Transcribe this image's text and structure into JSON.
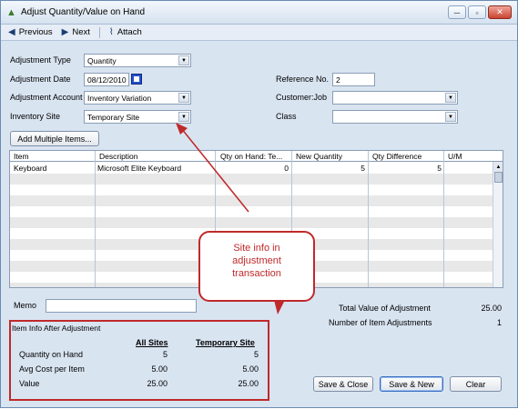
{
  "window": {
    "title": "Adjust Quantity/Value on Hand",
    "min": "─",
    "restore": "▫",
    "close": "✕"
  },
  "toolbar": {
    "previous": "Previous",
    "next": "Next",
    "attach": "Attach"
  },
  "form": {
    "adjustment_type_label": "Adjustment Type",
    "adjustment_type": "Quantity",
    "adjustment_date_label": "Adjustment Date",
    "adjustment_date": "08/12/2010",
    "adjustment_account_label": "Adjustment Account",
    "adjustment_account": "Inventory Variation",
    "inventory_site_label": "Inventory Site",
    "inventory_site": "Temporary Site",
    "reference_label": "Reference No.",
    "reference": "2",
    "customer_job_label": "Customer:Job",
    "customer_job": "",
    "class_label": "Class",
    "class_value": ""
  },
  "add_multiple_items": "Add Multiple Items...",
  "grid": {
    "headers": [
      "Item",
      "Description",
      "Qty on Hand: Te...",
      "New Quantity",
      "Qty Difference",
      "U/M"
    ],
    "rows": [
      {
        "item": "Keyboard",
        "description": "Microsoft Elite Keyboard",
        "qty_on_hand": "0",
        "new_quantity": "5",
        "qty_difference": "5",
        "um": ""
      }
    ]
  },
  "callout": {
    "line1": "Site info in",
    "line2": "adjustment",
    "line3": "transaction"
  },
  "memo_label": "Memo",
  "totals": {
    "total_value_label": "Total Value of Adjustment",
    "total_value": "25.00",
    "num_adjustments_label": "Number of Item Adjustments",
    "num_adjustments": "1"
  },
  "info": {
    "title": "Item Info After Adjustment",
    "col_all": "All Sites",
    "col_temp": "Temporary Site",
    "rows": [
      {
        "label": "Quantity on Hand",
        "all": "5",
        "temp": "5"
      },
      {
        "label": "Avg Cost per Item",
        "all": "5.00",
        "temp": "5.00"
      },
      {
        "label": "Value",
        "all": "25.00",
        "temp": "25.00"
      }
    ]
  },
  "buttons": {
    "save_close": "Save & Close",
    "save_new": "Save & New",
    "clear": "Clear"
  },
  "colors": {
    "annotation": "#c0292a",
    "window_bg": "#d9e4f1"
  }
}
